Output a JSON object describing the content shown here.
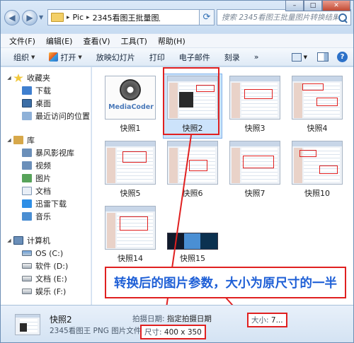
{
  "address": {
    "breadcrumb": [
      "Pic",
      "2345看图王批量图片转..."
    ],
    "search_placeholder": "搜索 2345看图王批量图片转换结果"
  },
  "window_buttons": {
    "minimize": "–",
    "maximize": "□",
    "close": "✕"
  },
  "menu": [
    "文件(F)",
    "编辑(E)",
    "查看(V)",
    "工具(T)",
    "帮助(H)"
  ],
  "toolbar": {
    "organize": "组织",
    "open": "打开",
    "slideshow": "放映幻灯片",
    "print": "打印",
    "email": "电子邮件",
    "burn": "刻录",
    "more": "»"
  },
  "nav": {
    "favorites": "收藏夹",
    "downloads": "下载",
    "desktop": "桌面",
    "recent": "最近访问的位置",
    "libraries": "库",
    "storm": "暴风影视库",
    "videos": "视频",
    "pictures": "图片",
    "documents": "文档",
    "xunlei": "迅雷下载",
    "music": "音乐",
    "computer": "计算机",
    "drive_c": "OS (C:)",
    "drive_d": "软件 (D:)",
    "drive_e": "文档 (E:)",
    "drive_f": "娱乐 (F:)"
  },
  "files": [
    {
      "label": "快照1"
    },
    {
      "label": "快照2"
    },
    {
      "label": "快照3"
    },
    {
      "label": "快照4"
    },
    {
      "label": "快照5"
    },
    {
      "label": "快照6"
    },
    {
      "label": "快照7"
    },
    {
      "label": "快照10"
    },
    {
      "label": "快照14"
    },
    {
      "label": "快照15"
    }
  ],
  "thumb_logo_text": "MediaCoder",
  "callout": "转换后的图片参数，大小为原尺寸的一半",
  "details": {
    "name": "快照2",
    "type": "2345看图王 PNG 图片文件",
    "date_label": "拍摄日期:",
    "date_value": "指定拍摄日期",
    "dimensions_label": "尺寸:",
    "dimensions_value": "400 x 350",
    "size_label": "大小:",
    "size_value": "7..."
  },
  "colors": {
    "annotation_red": "#e02020",
    "callout_blue": "#1e5fd6",
    "selection": "#cce3fb"
  }
}
